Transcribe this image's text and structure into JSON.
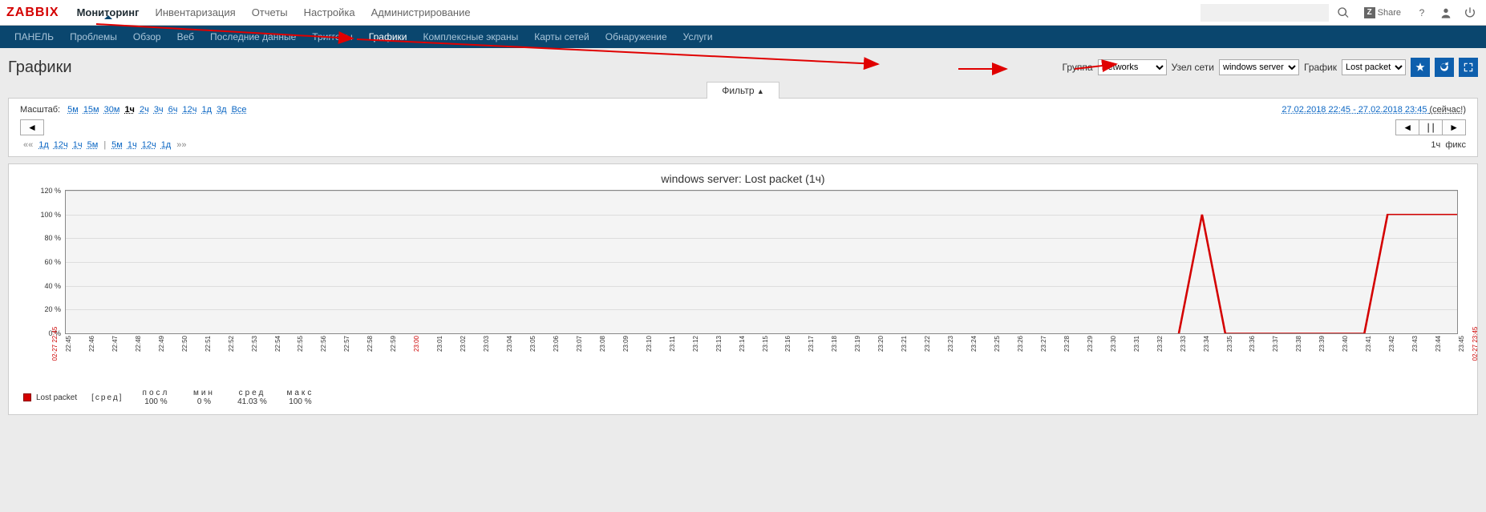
{
  "logo": "ZABBIX",
  "top_nav": {
    "items": [
      "Мониторинг",
      "Инвентаризация",
      "Отчеты",
      "Настройка",
      "Администрирование"
    ],
    "active": 0
  },
  "share_label": "Share",
  "sub_nav": {
    "items": [
      "ПАНЕЛЬ",
      "Проблемы",
      "Обзор",
      "Веб",
      "Последние данные",
      "Триггеры",
      "Графики",
      "Комплексные экраны",
      "Карты сетей",
      "Обнаружение",
      "Услуги"
    ],
    "active": 6
  },
  "page_title": "Графики",
  "selectors": {
    "group_label": "Группа",
    "group_value": "Networks",
    "host_label": "Узел сети",
    "host_value": "windows server",
    "graph_label": "График",
    "graph_value": "Lost packet"
  },
  "filter_tab": "Фильтр",
  "zoom": {
    "label": "Масштаб:",
    "items": [
      "5м",
      "15м",
      "30м",
      "1ч",
      "2ч",
      "3ч",
      "6ч",
      "12ч",
      "1д",
      "3д",
      "Все"
    ],
    "active": 3
  },
  "time_range": {
    "from": "27.02.2018 22:45",
    "to": "27.02.2018 23:45",
    "now": "(сейчас!)"
  },
  "nav_btns": {
    "left": "◄",
    "right": "►",
    "sep1": "◄",
    "sep2": "∣∣",
    "sep3": "►"
  },
  "shift": {
    "left_lbl": "««",
    "left_items": [
      "1д",
      "12ч",
      "1ч",
      "5м"
    ],
    "right_items": [
      "5м",
      "1ч",
      "12ч",
      "1д"
    ],
    "right_lbl": "»»",
    "sep": "|"
  },
  "fix_info": {
    "dur": "1ч",
    "fix": "фикс"
  },
  "chart_data": {
    "type": "line",
    "title": "windows server: Lost packet (1ч)",
    "ylabel": "%",
    "ylim": [
      0,
      120
    ],
    "y_ticks": [
      0,
      20,
      40,
      60,
      80,
      100,
      120
    ],
    "x_start": "02-27 22:45",
    "x_end": "02-27 23:45",
    "x_ticks": [
      "22:45",
      "22:46",
      "22:47",
      "22:48",
      "22:49",
      "22:50",
      "22:51",
      "22:52",
      "22:53",
      "22:54",
      "22:55",
      "22:56",
      "22:57",
      "22:58",
      "22:59",
      "23:00",
      "23:01",
      "23:02",
      "23:03",
      "23:04",
      "23:05",
      "23:06",
      "23:07",
      "23:08",
      "23:09",
      "23:10",
      "23:11",
      "23:12",
      "23:13",
      "23:14",
      "23:15",
      "23:16",
      "23:17",
      "23:18",
      "23:19",
      "23:20",
      "23:21",
      "23:22",
      "23:23",
      "23:24",
      "23:25",
      "23:26",
      "23:27",
      "23:28",
      "23:29",
      "23:30",
      "23:31",
      "23:32",
      "23:33",
      "23:34",
      "23:35",
      "23:36",
      "23:37",
      "23:38",
      "23:39",
      "23:40",
      "23:41",
      "23:42",
      "23:43",
      "23:44",
      "23:45"
    ],
    "x_hour_mark": "23:00",
    "series": [
      {
        "name": "Lost packet",
        "color": "#d40000",
        "points": [
          {
            "x": "23:33",
            "y": 0
          },
          {
            "x": "23:34",
            "y": 100
          },
          {
            "x": "23:35",
            "y": 0
          },
          {
            "x": "23:36",
            "y": 0
          },
          {
            "x": "23:37",
            "y": 0
          },
          {
            "x": "23:38",
            "y": 0
          },
          {
            "x": "23:39",
            "y": 0
          },
          {
            "x": "23:40",
            "y": 0
          },
          {
            "x": "23:41",
            "y": 0
          },
          {
            "x": "23:42",
            "y": 100
          },
          {
            "x": "23:43",
            "y": 100
          },
          {
            "x": "23:44",
            "y": 100
          },
          {
            "x": "23:45",
            "y": 100
          }
        ]
      }
    ],
    "legend": {
      "name": "Lost packet",
      "agg": "[сред]",
      "cols": [
        {
          "h": "посл",
          "v": "100 %"
        },
        {
          "h": "мин",
          "v": "0 %"
        },
        {
          "h": "сред",
          "v": "41.03 %"
        },
        {
          "h": "макс",
          "v": "100 %"
        }
      ]
    }
  }
}
